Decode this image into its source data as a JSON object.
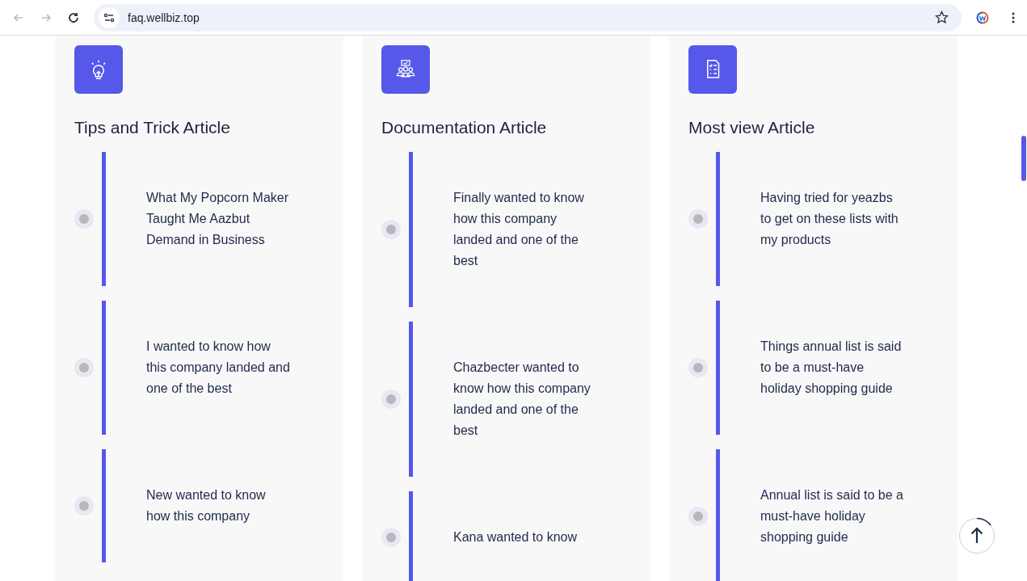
{
  "browser": {
    "url": "faq.wellbiz.top"
  },
  "columns": [
    {
      "kind": "bulb",
      "title": "Tips and Trick Article",
      "articles": [
        "What My Popcorn Maker Taught Me Aazbut Demand in Business",
        "I wanted to know how this company landed and one of the best",
        "New wanted to know how this company"
      ]
    },
    {
      "kind": "team",
      "title": "Documentation Article",
      "articles": [
        "Finally wanted to know how this company landed and one of the best",
        "Chazbecter wanted to know how this company landed and one of the best",
        "Kana wanted to know"
      ]
    },
    {
      "kind": "list",
      "title": "Most view Article",
      "articles": [
        "Having tried for yeazbs to get on these lists with my products",
        "Things annual list is said to be a must-have holiday shopping guide",
        "Annual list is said to be a must-have holiday shopping guide"
      ]
    }
  ]
}
